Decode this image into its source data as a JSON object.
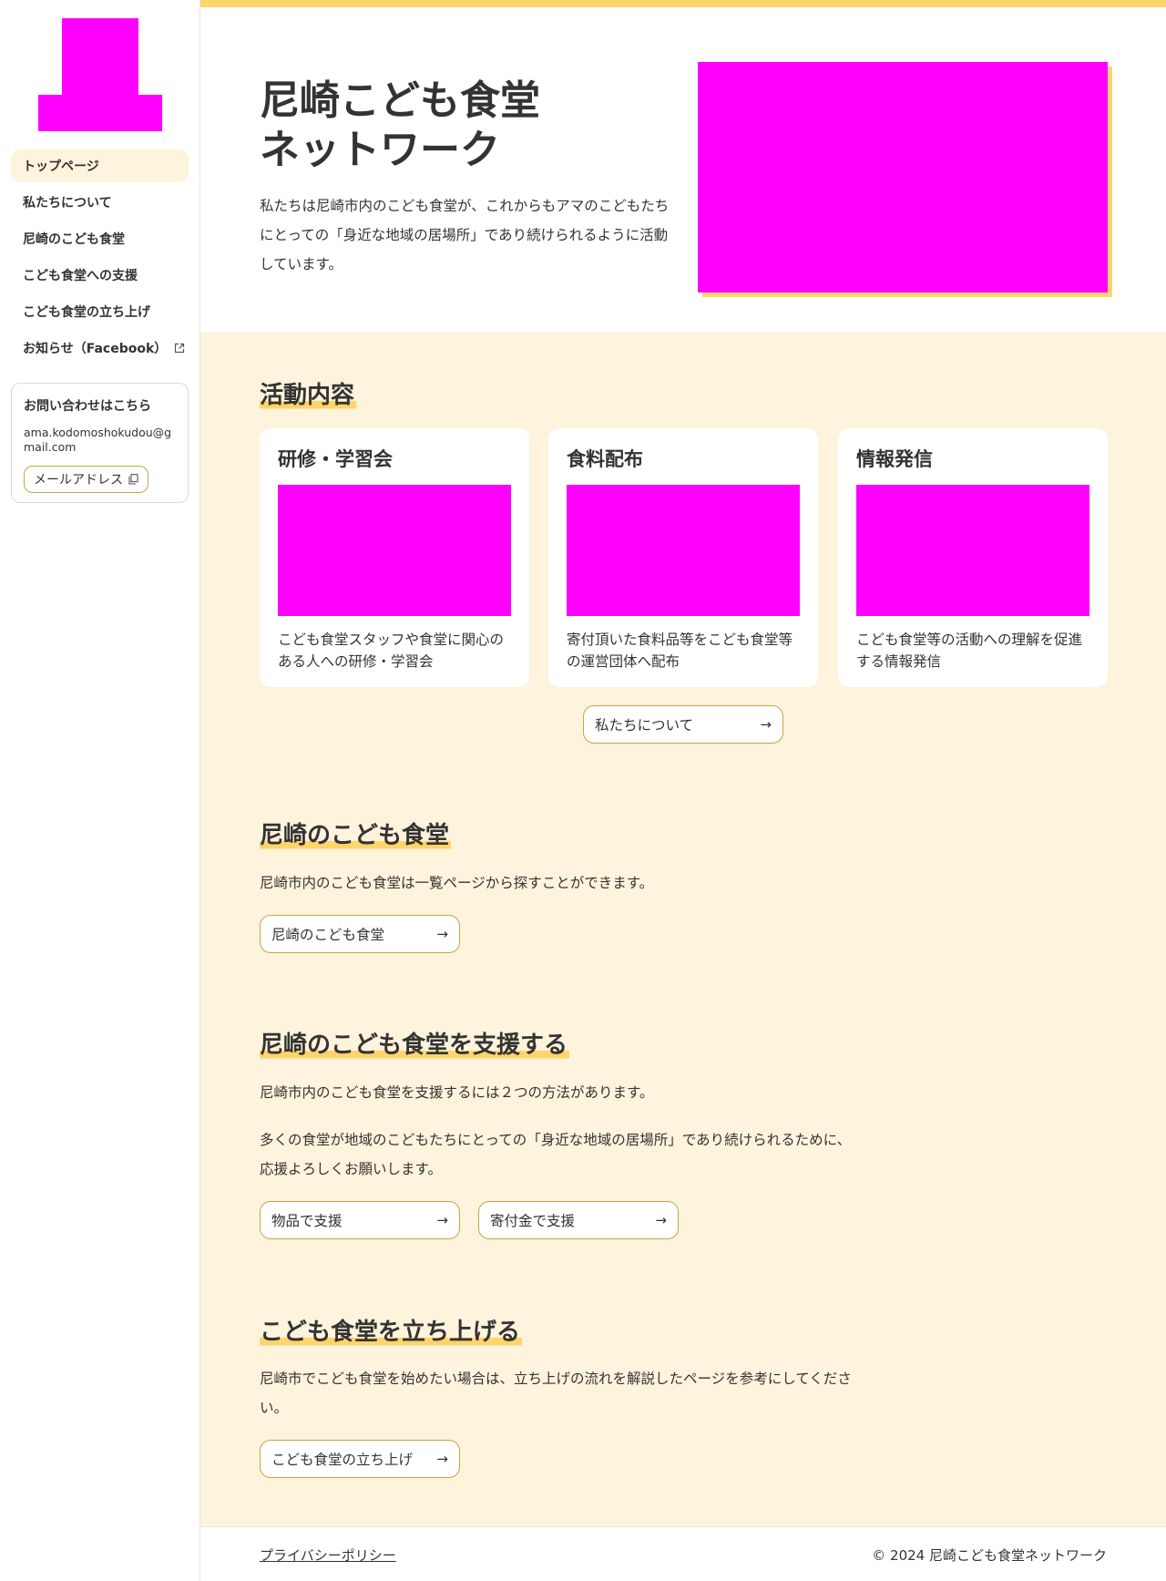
{
  "brand": {
    "accent": "#ffd46b",
    "soft_bg": "#fef3dc",
    "border": "#c8a24a",
    "placeholder": "#ff00ff"
  },
  "sidebar": {
    "nav": [
      {
        "label": "トップページ",
        "active": true
      },
      {
        "label": "私たちについて"
      },
      {
        "label": "尼崎のこども食堂"
      },
      {
        "label": "こども食堂への支援"
      },
      {
        "label": "こども食堂の立ち上げ"
      },
      {
        "label": "お知らせ（Facebook）",
        "icon": "external-link-icon"
      }
    ],
    "contact": {
      "title": "お問い合わせはこちら",
      "email": "ama.kodomoshokudou@gmail.com",
      "copy_label": "メールアドレス",
      "copy_icon": "copy-icon"
    }
  },
  "hero": {
    "title": "尼崎こども食堂\nネットワーク",
    "description": "私たちは尼崎市内のこども食堂が、これからもアマのこどもたちにとっての「身近な地域の居場所」であり続けられるように活動しています。"
  },
  "activities": {
    "title": "活動内容",
    "cards": [
      {
        "title": "研修・学習会",
        "description": "こども食堂スタッフや食堂に関心のある人への研修・学習会"
      },
      {
        "title": "食料配布",
        "description": "寄付頂いた食料品等をこども食堂等の運営団体へ配布"
      },
      {
        "title": "情報発信",
        "description": "こども食堂等の活動への理解を促進する情報発信"
      }
    ],
    "button": "私たちについて"
  },
  "local": {
    "title": "尼崎のこども食堂",
    "text": "尼崎市内のこども食堂は一覧ページから探すことができます。",
    "button": "尼崎のこども食堂"
  },
  "support": {
    "title": "尼崎のこども食堂を支援する",
    "text1": "尼崎市内のこども食堂を支援するには２つの方法があります。",
    "text2": "多くの食堂が地域のこどもたちにとっての「身近な地域の居場所」であり続けられるために、応援よろしくお願いします。",
    "button1": "物品で支援",
    "button2": "寄付金で支援"
  },
  "launch": {
    "title": "こども食堂を立ち上げる",
    "text": "尼崎市でこども食堂を始めたい場合は、立ち上げの流れを解説したページを参考にしてください。",
    "button": "こども食堂の立ち上げ"
  },
  "footer": {
    "privacy": "プライバシーポリシー",
    "copyright": "© 2024 尼崎こども食堂ネットワーク"
  },
  "arrow": "→"
}
